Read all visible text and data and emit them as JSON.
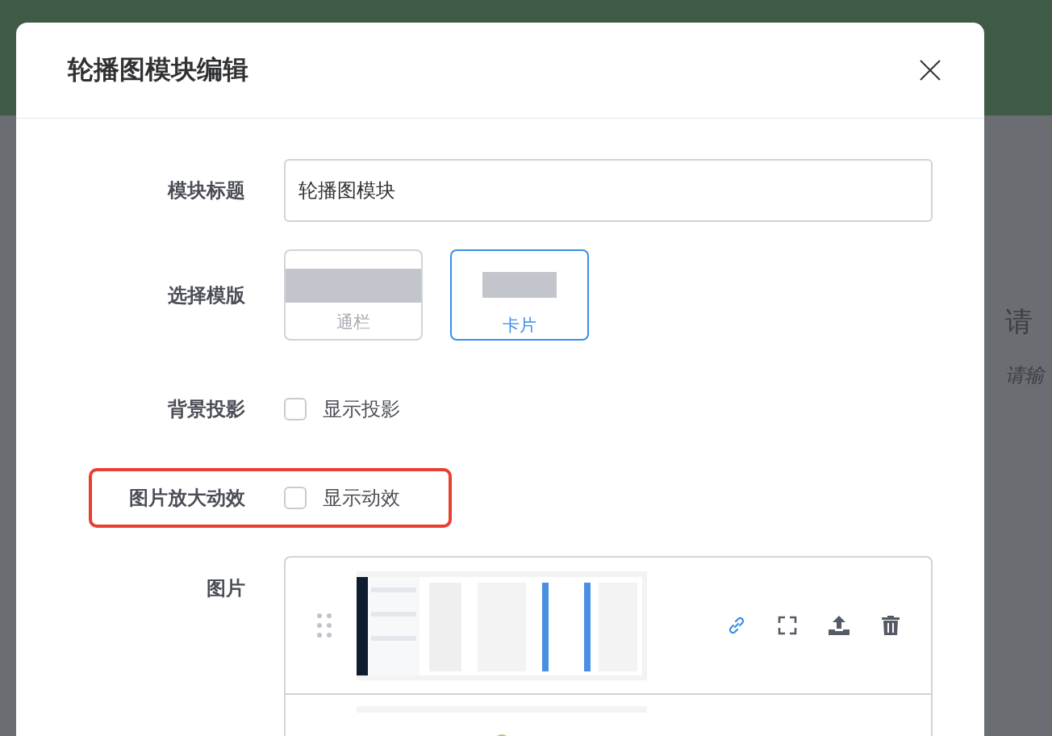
{
  "background": {
    "heading": "请",
    "subheading": "请输"
  },
  "dialog": {
    "title": "轮播图模块编辑",
    "fields": [
      {
        "kind": "text",
        "label": "模块标题",
        "value": "轮播图模块",
        "highlighted": false
      },
      {
        "kind": "templates",
        "label": "选择模版",
        "highlighted": false,
        "options": [
          {
            "label": "通栏",
            "kind": "full",
            "selected": false
          },
          {
            "label": "卡片",
            "kind": "card",
            "selected": true
          }
        ]
      },
      {
        "kind": "checkbox",
        "label": "背景投影",
        "text": "显示投影",
        "checked": false,
        "highlighted": false
      },
      {
        "kind": "checkbox",
        "label": "图片放大动效",
        "text": "显示动效",
        "checked": false,
        "highlighted": true
      },
      {
        "kind": "images",
        "label": "图片",
        "highlighted": false,
        "items": [
          {
            "kind": "picture",
            "actions": true
          },
          {
            "kind": "picture",
            "actions": false
          }
        ]
      }
    ]
  }
}
